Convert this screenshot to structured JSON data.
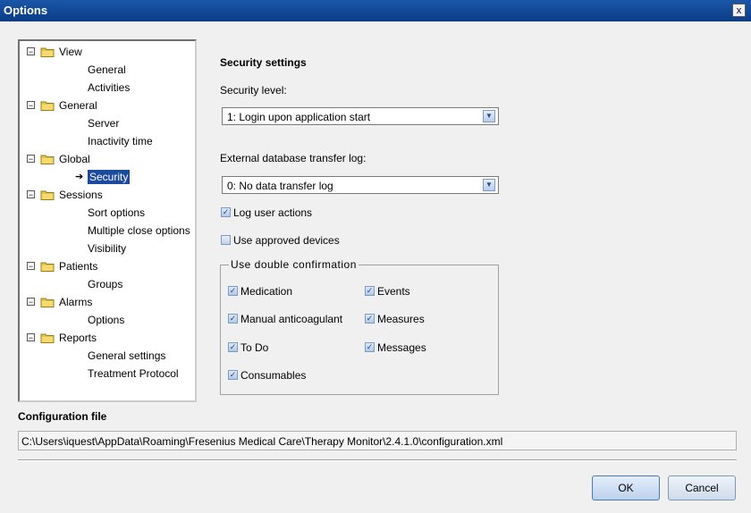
{
  "window": {
    "title": "Options",
    "close_glyph": "x"
  },
  "tree": {
    "items": [
      {
        "label": "View",
        "level": 0,
        "expander": "−"
      },
      {
        "label": "General",
        "level": 1
      },
      {
        "label": "Activities",
        "level": 1
      },
      {
        "label": "General",
        "level": 0,
        "expander": "−"
      },
      {
        "label": "Server",
        "level": 1
      },
      {
        "label": "Inactivity time",
        "level": 1
      },
      {
        "label": "Global",
        "level": 0,
        "expander": "−"
      },
      {
        "label": "Security",
        "level": 1,
        "selected": true
      },
      {
        "label": "Sessions",
        "level": 0,
        "expander": "−"
      },
      {
        "label": "Sort options",
        "level": 1
      },
      {
        "label": "Multiple close options",
        "level": 1
      },
      {
        "label": "Visibility",
        "level": 1
      },
      {
        "label": "Patients",
        "level": 0,
        "expander": "−"
      },
      {
        "label": "Groups",
        "level": 1
      },
      {
        "label": "Alarms",
        "level": 0,
        "expander": "−"
      },
      {
        "label": "Options",
        "level": 1
      },
      {
        "label": "Reports",
        "level": 0,
        "expander": "−"
      },
      {
        "label": "General settings",
        "level": 1
      },
      {
        "label": "Treatment Protocol",
        "level": 1
      }
    ]
  },
  "security": {
    "title": "Security settings",
    "level_label": "Security level:",
    "level_value": "1: Login upon application start",
    "transfer_label": "External database transfer log:",
    "transfer_value": "0: No data transfer log",
    "log_user_actions": {
      "label": "Log user actions",
      "checked": true
    },
    "approved_devices": {
      "label": "Use approved devices",
      "checked": false
    },
    "double_confirmation": {
      "legend": "Use double confirmation",
      "left": [
        {
          "label": "Medication",
          "checked": true
        },
        {
          "label": "Manual anticoagulant",
          "checked": true
        },
        {
          "label": "To Do",
          "checked": true
        },
        {
          "label": "Consumables",
          "checked": true
        }
      ],
      "right": [
        {
          "label": "Events",
          "checked": true
        },
        {
          "label": "Measures",
          "checked": true
        },
        {
          "label": "Messages",
          "checked": true
        }
      ]
    }
  },
  "config": {
    "title": "Configuration file",
    "path": "C:\\Users\\iquest\\AppData\\Roaming\\Fresenius Medical Care\\Therapy Monitor\\2.4.1.0\\configuration.xml"
  },
  "buttons": {
    "ok": "OK",
    "cancel": "Cancel"
  },
  "icons": {
    "check_glyph": "✓",
    "dropdown_glyph": "▼",
    "selected_arrow_glyph": "➔"
  },
  "colors": {
    "titlebar": "#0a3c86",
    "selection": "#1c4a9c"
  }
}
